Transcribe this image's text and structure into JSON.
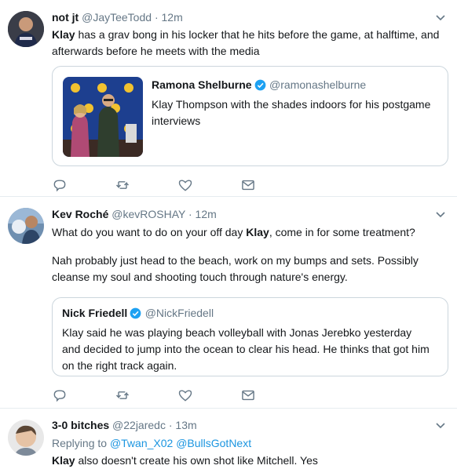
{
  "tweets": [
    {
      "name": "not jt",
      "handle": "@JayTeeTodd",
      "dot": "·",
      "time": "12m",
      "lead": "Klay",
      "text": " has a grav bong in his locker that he hits before the game, at halftime, and afterwards before he meets with the media",
      "quote": {
        "name": "Ramona Shelburne",
        "handle": "@ramonashelburne",
        "text": "Klay Thompson with the shades indoors for his postgame interviews"
      }
    },
    {
      "name": "Kev Roché",
      "handle": "@kevROSHAY",
      "dot": "·",
      "time": "12m",
      "line1_pre": "What do you want to do on your off day ",
      "line1_bold": "Klay",
      "line1_post": ", come in for some treatment?",
      "line2": "Nah probably just head to the beach, work on my bumps and sets. Possibly cleanse my soul and shooting touch through nature's energy.",
      "quote": {
        "name": "Nick Friedell",
        "handle": "@NickFriedell",
        "text": "Klay said he was playing beach volleyball with Jonas Jerebko yesterday and decided to jump into the ocean to clear his head. He thinks that got him on the right track again."
      }
    },
    {
      "name": "3-0 bitches",
      "handle": "@22jaredc",
      "dot": "·",
      "time": "13m",
      "reply_prefix": "Replying to ",
      "reply_user1": "@Twan_X02",
      "reply_user2": "@BullsGotNext",
      "lead": "Klay",
      "text": " also doesn't create his own shot like Mitchell. Yes"
    }
  ],
  "icons": {
    "reply": "reply-icon",
    "retweet": "retweet-icon",
    "like": "like-icon",
    "dm": "envelope-icon",
    "verified": "verified-badge-icon",
    "chevron": "chevron-down-icon"
  },
  "colors": {
    "accent": "#1b95e0",
    "muted": "#657786",
    "border": "#e6ecf0",
    "verified": "#1da1f2"
  }
}
